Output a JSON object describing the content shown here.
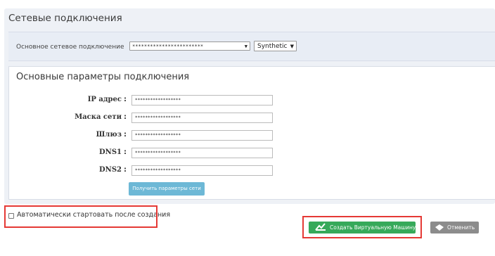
{
  "network": {
    "title": "Сетевые подключения",
    "main_connection_label": "Основное сетевое подключение",
    "main_connection_value": "************************",
    "adapter_type": "Synthetic"
  },
  "params": {
    "title": "Основные параметры подключения",
    "fields": [
      {
        "label": "IP адрес",
        "value": "******************"
      },
      {
        "label": "Маска сети",
        "value": "******************"
      },
      {
        "label": "Шлюз",
        "value": "******************"
      },
      {
        "label": "DNS1",
        "value": "******************"
      },
      {
        "label": "DNS2",
        "value": "******************"
      }
    ],
    "get_params_button": "Получить параметры сети"
  },
  "autostart": {
    "label": "Автоматически стартовать после создания",
    "checked": false
  },
  "actions": {
    "create_label": "Создать Виртуальную Машину",
    "cancel_label": "Отменить",
    "create_color": "#36a95a",
    "cancel_color": "#8c8c8c",
    "highlight_color": "#e53935"
  }
}
